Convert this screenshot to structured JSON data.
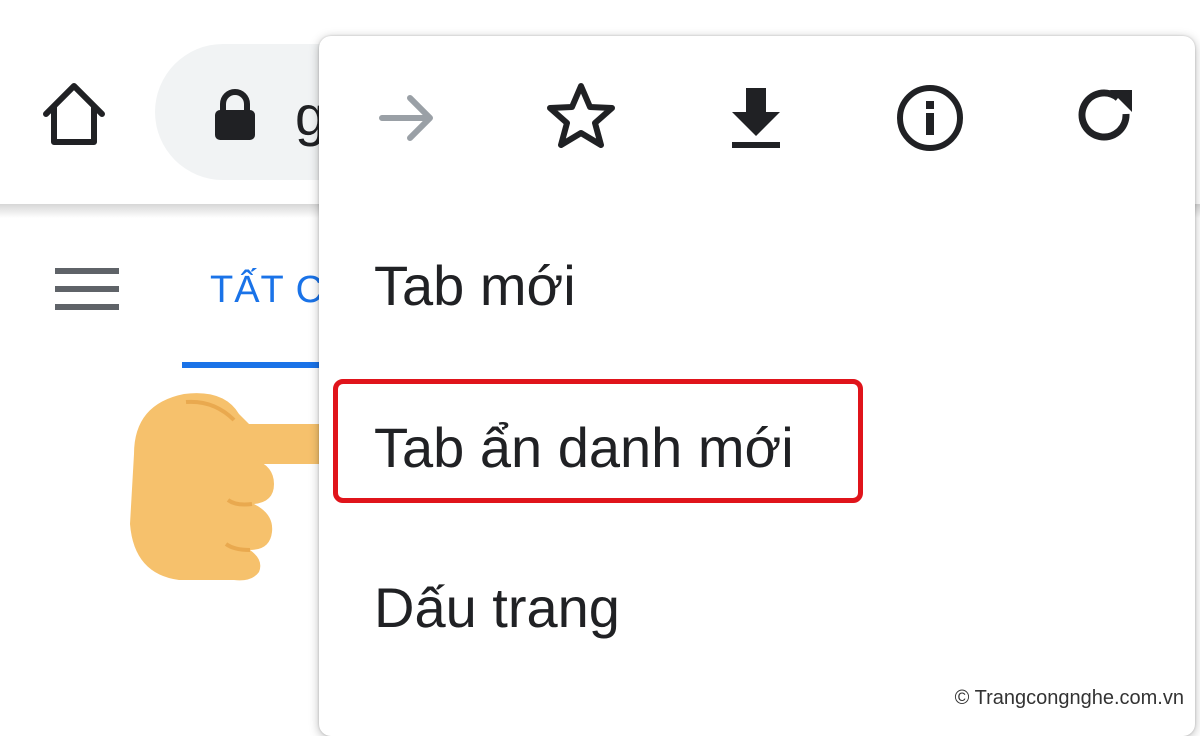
{
  "omnibox": {
    "url_partial": "g"
  },
  "tabs": {
    "all_label_partial": "TẤT C"
  },
  "menu": {
    "icons": [
      "forward-icon",
      "bookmark-star-icon",
      "download-icon",
      "info-icon",
      "refresh-icon"
    ],
    "forward_disabled": true,
    "items": [
      {
        "label": "Tab mới"
      },
      {
        "label": "Tab ẩn danh mới",
        "highlighted": true
      },
      {
        "label": "Dấu trang"
      }
    ]
  },
  "annotations": {
    "highlight_color": "#e0141b",
    "pointer": "pointing-hand-icon"
  },
  "watermark": {
    "text": "© Trangcongnghe.com.vn"
  },
  "colors": {
    "accent": "#1a73e8",
    "omnibox_bg": "#f1f3f4",
    "icon": "#3c4043",
    "disabled_icon": "#9aa0a6"
  }
}
